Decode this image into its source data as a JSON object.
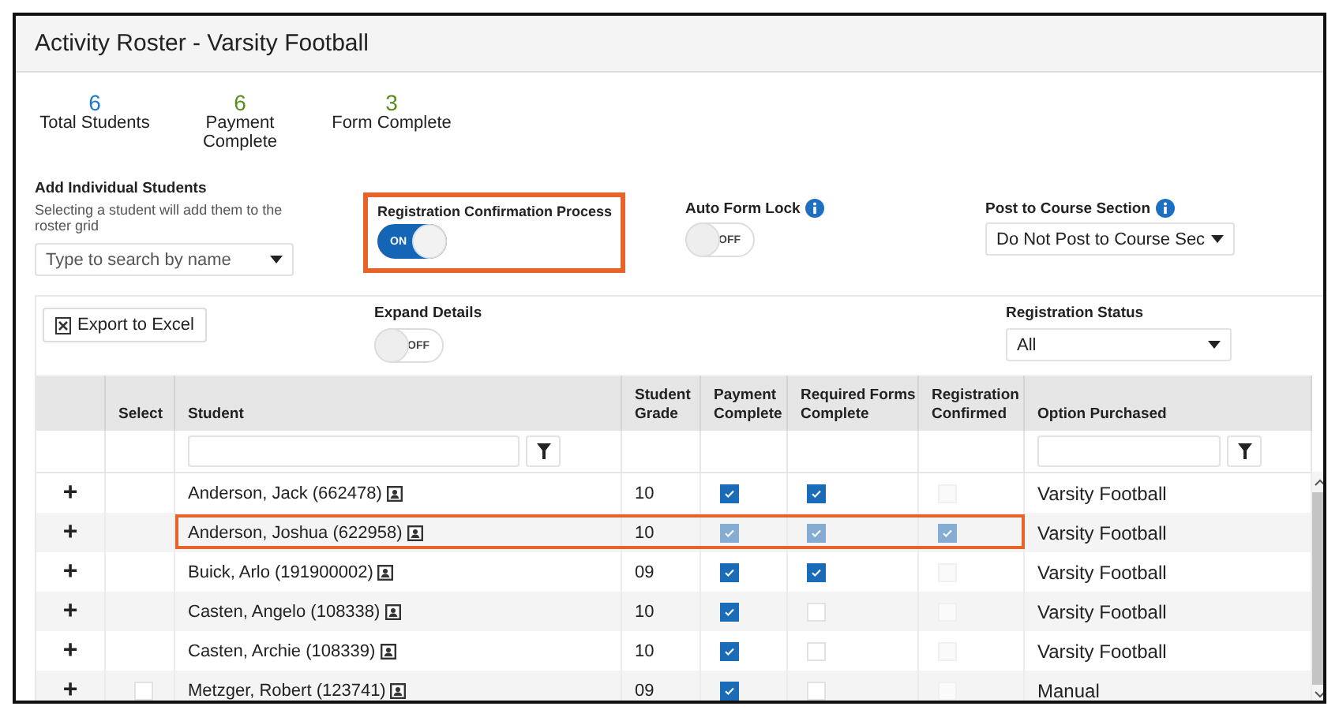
{
  "window": {
    "title": "Activity Roster - Varsity Football"
  },
  "stats": [
    {
      "value": "6",
      "label": "Total Students",
      "color": "#1f78c8"
    },
    {
      "value": "6",
      "label": "Payment Complete",
      "color": "#5b8c1f"
    },
    {
      "value": "3",
      "label": "Form Complete",
      "color": "#5b8c1f"
    }
  ],
  "add_students": {
    "title": "Add Individual Students",
    "hint": "Selecting a student will add them to the roster grid",
    "search": {
      "placeholder": "Type to search by name"
    }
  },
  "registration_confirmation": {
    "label": "Registration Confirmation Process",
    "highlighted": true,
    "toggle": {
      "on": true,
      "text": "ON"
    }
  },
  "auto_form_lock": {
    "label": "Auto Form Lock",
    "info": true,
    "toggle": {
      "on": false,
      "text": "OFF"
    }
  },
  "post_to_course_section": {
    "label": "Post to Course Section",
    "info": true,
    "value": "Do Not Post to Course Sec"
  },
  "export_button": "Export to Excel",
  "expand_details": {
    "label": "Expand Details",
    "toggle": {
      "on": false,
      "text": "OFF"
    }
  },
  "registration_status": {
    "label": "Registration Status",
    "value": "All"
  },
  "table": {
    "columns": [
      {
        "label": "Select",
        "filter": false
      },
      {
        "label": "Student",
        "filter": true
      },
      {
        "label": "Student Grade",
        "filter": false
      },
      {
        "label": "Payment Complete",
        "filter": false
      },
      {
        "label": "Required Forms Complete",
        "filter": false
      },
      {
        "label": "Registration Confirmed",
        "filter": false
      },
      {
        "label": "Option Purchased",
        "filter": true
      }
    ],
    "rows": [
      {
        "expand": "+",
        "student": "Anderson, Jack (662478)",
        "grade": "10",
        "payment": {
          "checked": true,
          "disabled": false
        },
        "forms": {
          "checked": true,
          "disabled": false
        },
        "confirmed": {
          "checked": false,
          "disabled": true
        },
        "option": "Varsity Football",
        "highlighted": false
      },
      {
        "expand": "+",
        "student": "Anderson, Joshua (622958)",
        "grade": "10",
        "payment": {
          "checked": true,
          "disabled": true
        },
        "forms": {
          "checked": true,
          "disabled": true
        },
        "confirmed": {
          "checked": true,
          "disabled": true
        },
        "option": "Varsity Football",
        "highlighted": true
      },
      {
        "expand": "+",
        "student": "Buick, Arlo (191900002)",
        "grade": "09",
        "payment": {
          "checked": true,
          "disabled": false
        },
        "forms": {
          "checked": true,
          "disabled": false
        },
        "confirmed": {
          "checked": false,
          "disabled": true
        },
        "option": "Varsity Football",
        "highlighted": false
      },
      {
        "expand": "+",
        "student": "Casten, Angelo (108338)",
        "grade": "10",
        "payment": {
          "checked": true,
          "disabled": false
        },
        "forms": {
          "checked": false,
          "disabled": false
        },
        "confirmed": {
          "checked": false,
          "disabled": true
        },
        "option": "Varsity Football",
        "highlighted": false
      },
      {
        "expand": "+",
        "student": "Casten, Archie (108339)",
        "grade": "10",
        "payment": {
          "checked": true,
          "disabled": false
        },
        "forms": {
          "checked": false,
          "disabled": false
        },
        "confirmed": {
          "checked": false,
          "disabled": true
        },
        "option": "Varsity Football",
        "highlighted": false
      },
      {
        "expand": "+",
        "student": "Metzger, Robert (123741)",
        "grade": "09",
        "select": {
          "checked": false
        },
        "payment": {
          "checked": true,
          "disabled": false
        },
        "forms": {
          "checked": false,
          "disabled": false
        },
        "confirmed": {
          "checked": false,
          "disabled": true
        },
        "option": "Manual",
        "highlighted": false
      }
    ]
  }
}
